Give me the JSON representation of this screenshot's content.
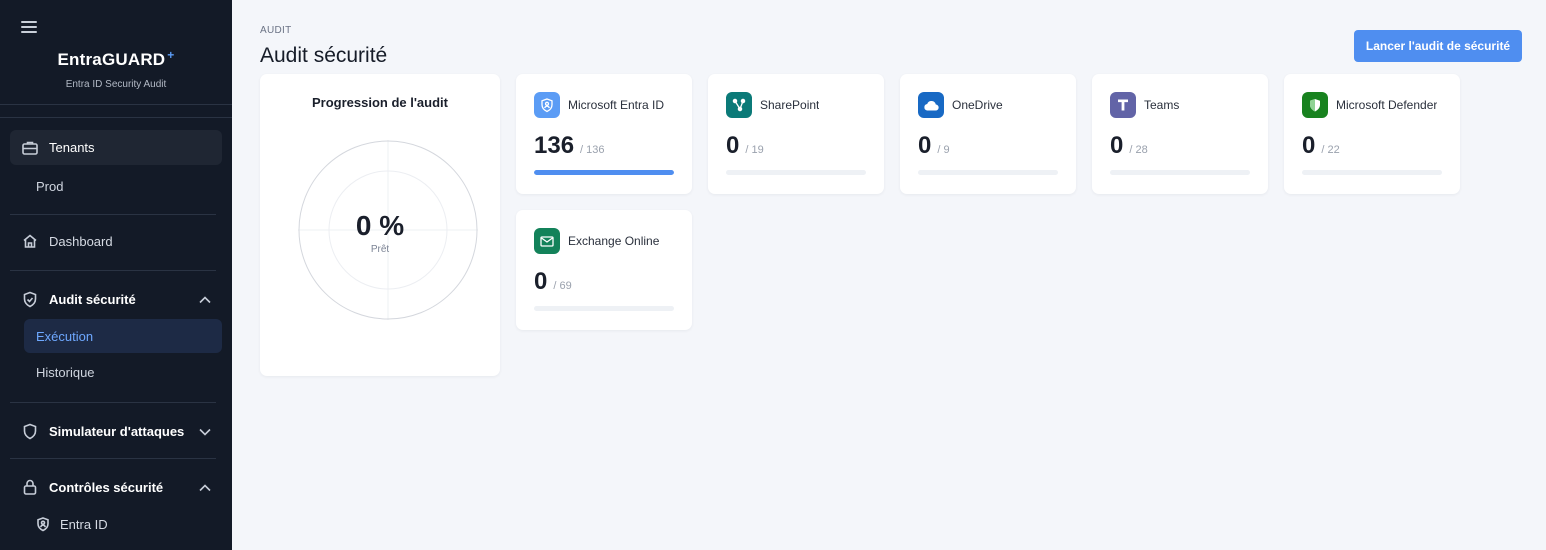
{
  "sidebar": {
    "brand_title": "EntraGUARD",
    "brand_plus": "+",
    "brand_subtitle": "Entra ID Security Audit",
    "tenants_label": "Tenants",
    "tenant_prod": "Prod",
    "dashboard_label": "Dashboard",
    "audit_section": "Audit sécurité",
    "execution_label": "Exécution",
    "historique_label": "Historique",
    "simulator_section": "Simulateur d'attaques",
    "controls_section": "Contrôles sécurité",
    "entra_label": "Entra ID"
  },
  "header": {
    "breadcrumb": "AUDIT",
    "title": "Audit sécurité",
    "launch_button": "Lancer l'audit de sécurité"
  },
  "progress": {
    "title": "Progression de l'audit",
    "percent_label": "0 %",
    "percent_value": 0,
    "status": "Prêt"
  },
  "services": [
    {
      "name": "Microsoft Entra ID",
      "count": "136",
      "total": "/ 136",
      "progress": 1.0,
      "color": "#5b9cf5",
      "icon": "shield-person-icon"
    },
    {
      "name": "SharePoint",
      "count": "0",
      "total": "/ 19",
      "progress": 0,
      "color": "#0b7a78",
      "icon": "share-icon"
    },
    {
      "name": "OneDrive",
      "count": "0",
      "total": "/ 9",
      "progress": 0,
      "color": "#1869c4",
      "icon": "cloud-icon"
    },
    {
      "name": "Teams",
      "count": "0",
      "total": "/ 28",
      "progress": 0,
      "color": "#6264a7",
      "icon": "teams-icon"
    },
    {
      "name": "Microsoft Defender",
      "count": "0",
      "total": "/ 22",
      "progress": 0,
      "color": "#18821f",
      "icon": "shield-icon"
    },
    {
      "name": "Exchange Online",
      "count": "0",
      "total": "/ 69",
      "progress": 0,
      "color": "#13825a",
      "icon": "mail-icon"
    }
  ],
  "colors": {
    "sidebar_bg": "#131a27",
    "accent": "#4f8ef0",
    "active_text": "#6ea8ff",
    "page_bg": "#f4f6fa"
  }
}
